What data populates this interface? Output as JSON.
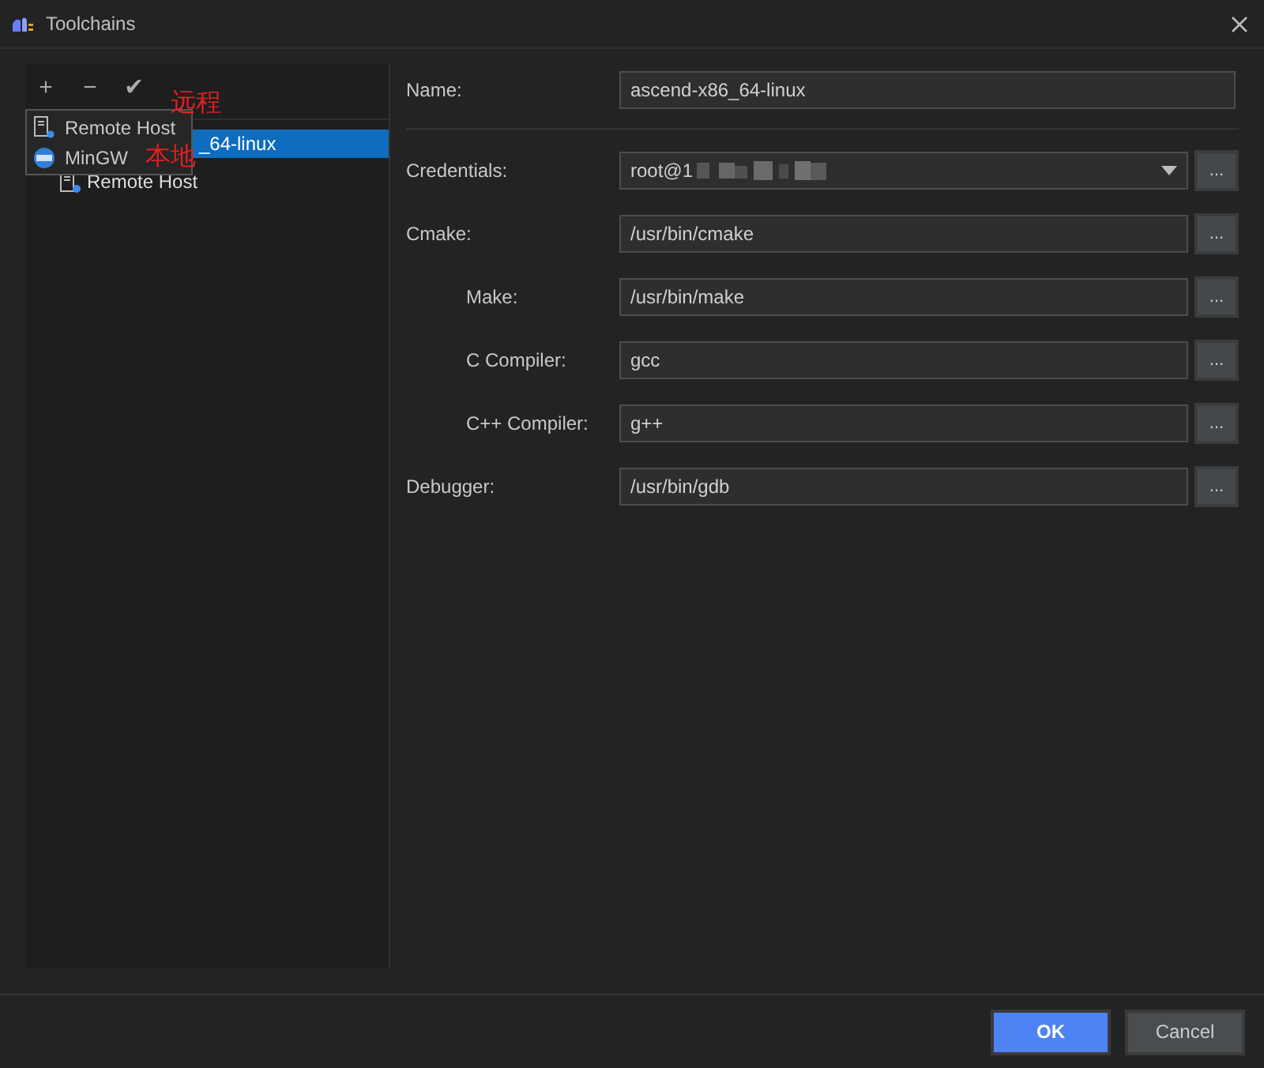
{
  "window": {
    "title": "Toolchains"
  },
  "toolbar": [
    "+",
    "−",
    "✔"
  ],
  "tree": {
    "items": [
      {
        "label": "_64-linux",
        "selected": true,
        "children": [
          {
            "label": "Remote Host",
            "selected": false
          }
        ]
      }
    ]
  },
  "popup_menu": {
    "items": [
      {
        "label": "Remote Host",
        "kind": "remote"
      },
      {
        "label": "MinGW",
        "kind": "mingw"
      }
    ]
  },
  "annotations": [
    {
      "text": "远程",
      "kind": "remote"
    },
    {
      "text": "本地",
      "kind": "local"
    }
  ],
  "form": {
    "name": {
      "label": "Name:",
      "value": "ascend-x86_64-linux"
    },
    "fields": [
      {
        "label": "Credentials:",
        "value": "root@1",
        "kind": "combo"
      },
      {
        "label": "Cmake:",
        "value": "/usr/bin/cmake",
        "kind": "path"
      },
      {
        "label": "Make:",
        "value": "/usr/bin/make",
        "kind": "subpath"
      },
      {
        "label": "C Compiler:",
        "value": "gcc",
        "kind": "subpath"
      },
      {
        "label": "C++ Compiler:",
        "value": "g++",
        "kind": "subpath"
      },
      {
        "label": "Debugger:",
        "value": "/usr/bin/gdb",
        "kind": "path"
      }
    ],
    "browse_label": "..."
  },
  "buttons": [
    {
      "label": "OK",
      "kind": "primary"
    },
    {
      "label": "Cancel",
      "kind": "secondary"
    }
  ]
}
